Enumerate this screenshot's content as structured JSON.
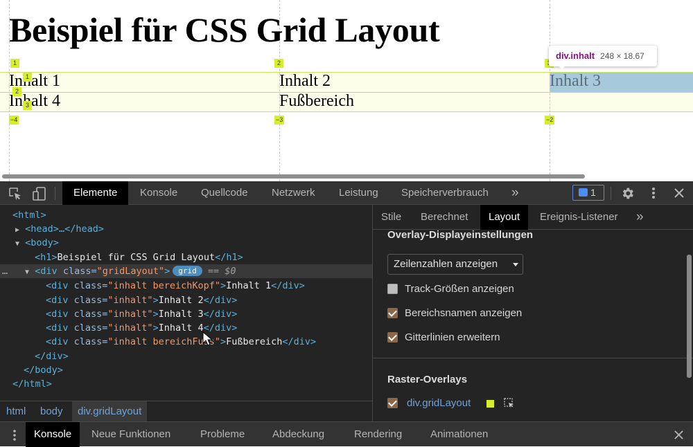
{
  "page": {
    "title": "Beispiel für CSS Grid Layout",
    "cells": [
      "Inhalt 1",
      "Inhalt 2",
      "Inhalt 3",
      "Inhalt 4",
      "Fußbereich"
    ],
    "col_badges_top": [
      "1",
      "2",
      "3"
    ],
    "row_badges": [
      "1",
      "2",
      "3"
    ],
    "col_badges_bottom": [
      "−4",
      "−3",
      "−2"
    ],
    "grid_line_color": "#c8e35a",
    "highlight_color": "#a6cadb"
  },
  "tooltip": {
    "selector": "div.inhalt",
    "size": "248 × 18.67"
  },
  "devtools": {
    "main_tabs": [
      "Elemente",
      "Konsole",
      "Quellcode",
      "Netzwerk",
      "Leistung",
      "Speicherverbrauch"
    ],
    "more_tabs": "»",
    "issues_count": "1",
    "dom": {
      "html_open": "<html>",
      "head": "<head>…</head>",
      "body_open": "<body>",
      "h1": {
        "open": "<h1>",
        "text": "Beispiel für CSS Grid Layout",
        "close": "</h1>"
      },
      "grid_div": {
        "open": "<div ",
        "attr": "class=",
        "value": "\"gridLayout\"",
        "gt": ">",
        "badge": "grid",
        "ref": "== $0"
      },
      "children": [
        {
          "attr": "class=",
          "value": "\"inhalt bereichKopf\"",
          "text": "Inhalt 1"
        },
        {
          "attr": "class=",
          "value": "\"inhalt\"",
          "text": "Inhalt 2"
        },
        {
          "attr": "class=",
          "value": "\"inhalt\"",
          "text": "Inhalt 3"
        },
        {
          "attr": "class=",
          "value": "\"inhalt\"",
          "text": "Inhalt 4"
        },
        {
          "attr": "class=",
          "value": "\"inhalt bereichFuss\"",
          "text": "Fußbereich"
        }
      ],
      "div_open": "<div ",
      "div_close": "</div>",
      "body_close": "</body>",
      "html_close": "</html>",
      "ellipsis": "…"
    },
    "breadcrumbs": [
      "html",
      "body",
      "div.gridLayout"
    ],
    "sidebar_tabs": [
      "Stile",
      "Berechnet",
      "Layout",
      "Ereignis-Listener"
    ],
    "layout": {
      "overlay_heading": "Overlay-Displayeinstellungen",
      "select_value": "Zeilenzahlen anzeigen",
      "checkboxes": [
        {
          "label": "Track-Größen anzeigen",
          "checked": false
        },
        {
          "label": "Bereichsnamen anzeigen",
          "checked": true
        },
        {
          "label": "Gitterlinien erweitern",
          "checked": true
        }
      ],
      "raster_heading": "Raster-Overlays",
      "raster_item": {
        "label": "div.gridLayout",
        "checked": true,
        "color": "#d7ef2b"
      }
    },
    "drawer_tabs": [
      "Konsole",
      "Neue Funktionen",
      "Probleme",
      "Abdeckung",
      "Rendering",
      "Animationen"
    ]
  }
}
